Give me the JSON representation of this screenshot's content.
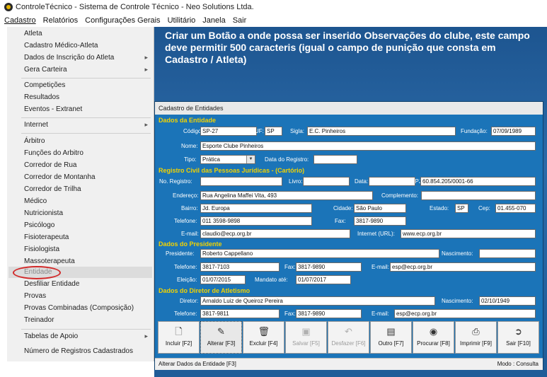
{
  "window": {
    "title": "ControleTécnico - Sistema de Controle Técnico - Neo Solutions Ltda."
  },
  "menubar": [
    "Cadastro",
    "Relatórios",
    "Configurações Gerais",
    "Utilitário",
    "Janela",
    "Sair"
  ],
  "cadastro_menu": {
    "items": [
      {
        "label": "Atleta"
      },
      {
        "label": "Cadastro Médico-Atleta"
      },
      {
        "label": "Dados de Inscrição do Atleta",
        "submenu": true
      },
      {
        "label": "Gera Carteira",
        "submenu": true
      },
      {
        "label": "Competições"
      },
      {
        "label": "Resultados"
      },
      {
        "label": "Eventos - Extranet"
      },
      {
        "label": "Internet",
        "submenu": true
      },
      {
        "label": "Árbitro"
      },
      {
        "label": "Funções do Arbitro"
      },
      {
        "label": "Corredor de Rua"
      },
      {
        "label": "Corredor de Montanha"
      },
      {
        "label": "Corredor de Trilha"
      },
      {
        "label": "Médico"
      },
      {
        "label": "Nutricionista"
      },
      {
        "label": "Psicólogo"
      },
      {
        "label": "Fisioterapeuta"
      },
      {
        "label": "Fisiologista"
      },
      {
        "label": "Massoterapeuta"
      },
      {
        "label": "Entidade",
        "highlighted": true
      },
      {
        "label": "Desfiliar Entidade"
      },
      {
        "label": "Provas"
      },
      {
        "label": "Provas Combinadas (Composição)"
      },
      {
        "label": "Treinador"
      },
      {
        "label": "Tabelas de Apoio",
        "submenu": true
      },
      {
        "label": "Número de Registros Cadastrados"
      }
    ]
  },
  "note": "Criar um Botão a onde possa ser inserido Observações do clube, este campo deve permitir 500 caracteris (igual o campo de punição que consta em Cadastro / Atleta)",
  "form": {
    "title": "Cadastro de Entidades",
    "sections": {
      "dados_entidade": "Dados da Entidade",
      "registro_civil": "Registro Civil das Pessoas Jurídicas - (Cartório)",
      "presidente": "Dados do Presidente",
      "diretor": "Dados do Diretor de Atletismo"
    },
    "labels": {
      "codigo": "Código:",
      "uf": "UF:",
      "sigla": "Sigla:",
      "fundacao": "Fundação:",
      "nome": "Nome:",
      "tipo": "Tipo:",
      "data_registro": "Data do Registro:",
      "no_registro": "No. Registro:",
      "livro": "Livro:",
      "data": "Data:",
      "cnpj": "CNPJ:",
      "endereco": "Endereço:",
      "complemento": "Complemento:",
      "bairro": "Bairro:",
      "cidade": "Cidade:",
      "estado": "Estado:",
      "cep": "Cep:",
      "telefone": "Telefone:",
      "fax": "Fax:",
      "email": "E-mail:",
      "internet": "Internet (URL):",
      "presidente": "Presidente:",
      "nascimento": "Nascimento:",
      "eleicao": "Eleição:",
      "mandato": "Mandato até:",
      "diretor": "Diretor:"
    },
    "values": {
      "codigo": "SP-27",
      "uf": "SP",
      "sigla": "E.C. Pinheiros",
      "fundacao": "07/09/1989",
      "nome": "Esporte Clube Pinheiros",
      "tipo": "Prática",
      "data_registro": "",
      "no_registro": "",
      "livro": "",
      "data": "",
      "cnpj": "60.854.205/0001-66",
      "endereco": "Rua Angelina Maffei Vita, 493",
      "complemento": "",
      "bairro": "Jd. Europa",
      "cidade": "São Paulo",
      "estado": "SP",
      "cep": "01.455-070",
      "telefone": "011 3598-9898",
      "fax": "3817-9890",
      "email": "claudio@ecp.org.br",
      "internet": "www.ecp.org.br",
      "presidente": "Roberto Cappellano",
      "pres_nascimento": "",
      "pres_telefone": "3817-7103",
      "pres_fax": "3817-9890",
      "pres_email": "esp@ecp.org.br",
      "eleicao": "01/07/2015",
      "mandato": "01/07/2017",
      "diretor": "Arnaldo Luiz de Queiroz Pereira",
      "dir_nascimento": "02/10/1949",
      "dir_telefone": "3817-9811",
      "dir_fax": "3817-9890",
      "dir_email": "esp@ecp.org.br"
    },
    "toolbar": [
      {
        "label": "Incluir [F2]",
        "icon": "new-document-icon",
        "enabled": true
      },
      {
        "label": "Alterar [F3]",
        "icon": "edit-pencil-icon",
        "enabled": true,
        "active": true
      },
      {
        "label": "Excluir [F4]",
        "icon": "trash-icon",
        "enabled": true
      },
      {
        "label": "Salvar [F5]",
        "icon": "floppy-disk-icon",
        "enabled": false
      },
      {
        "label": "Desfazer [F6]",
        "icon": "undo-icon",
        "enabled": false
      },
      {
        "label": "Outro [F7]",
        "icon": "document-icon",
        "enabled": true
      },
      {
        "label": "Procurar [F8]",
        "icon": "binoculars-icon",
        "enabled": true
      },
      {
        "label": "Imprimir [F9]",
        "icon": "printer-icon",
        "enabled": true
      },
      {
        "label": "Sair [F10]",
        "icon": "exit-door-icon",
        "enabled": true
      }
    ],
    "status_left": "Alterar Dados da Entidade [F3]",
    "status_right": "Modo : Consulta"
  },
  "colors": {
    "section_title": "#f2d200",
    "form_bg": "#1b74b8",
    "annotation_circle": "#d22a2a"
  }
}
